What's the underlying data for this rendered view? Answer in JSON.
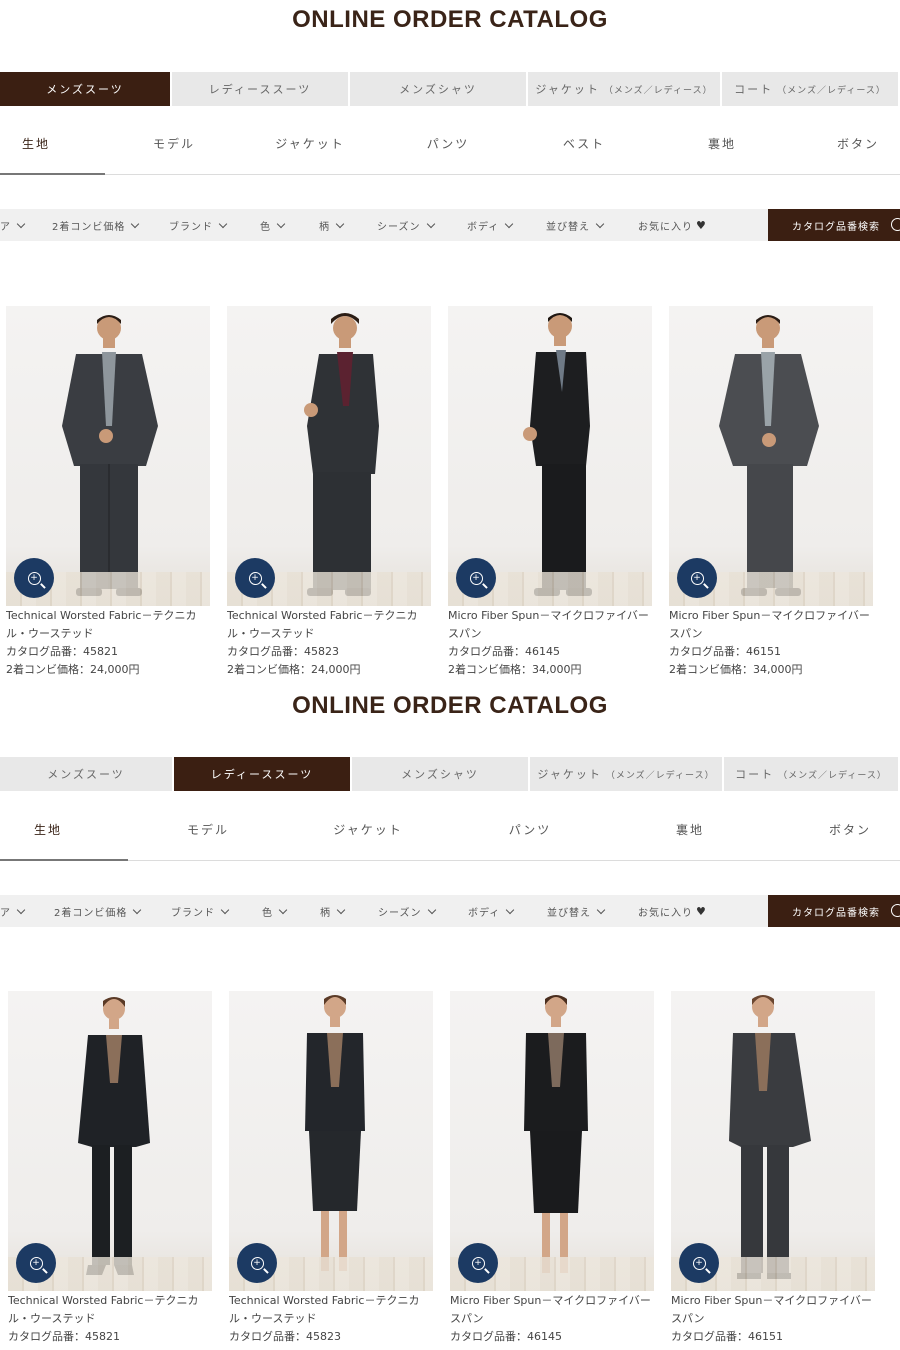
{
  "catalogs": [
    {
      "title": "ONLINE ORDER CATALOG",
      "tabs": [
        {
          "label": "メンズスーツ",
          "sub": ""
        },
        {
          "label": "レディーススーツ",
          "sub": ""
        },
        {
          "label": "メンズシャツ",
          "sub": ""
        },
        {
          "label": "ジャケット",
          "sub": "（メンズ／レディース）"
        },
        {
          "label": "コート",
          "sub": "（メンズ／レディース）"
        }
      ],
      "active_tab": "メンズスーツ",
      "subnav": [
        "生地",
        "モデル",
        "ジャケット",
        "パンツ",
        "ベスト",
        "裏地",
        "ボタン"
      ],
      "active_subnav": "生地",
      "filters": [
        "ア",
        "2着コンビ価格",
        "ブランド",
        "色",
        "柄",
        "シーズン",
        "ボディ",
        "並び替え",
        "お気に入り"
      ],
      "search_button": "カタログ品番検索",
      "products": [
        {
          "name_line1": "Technical Worsted Fabric－テクニカ",
          "name_line2": "ル・ウーステッド",
          "catalog_no": "カタログ品番：45821",
          "price": "2着コンビ価格：24,000円"
        },
        {
          "name_line1": "Technical Worsted Fabric－テクニカ",
          "name_line2": "ル・ウーステッド",
          "catalog_no": "カタログ品番：45823",
          "price": "2着コンビ価格：24,000円"
        },
        {
          "name_line1": "Micro Fiber Spun－マイクロファイバー",
          "name_line2": "スパン",
          "catalog_no": "カタログ品番：46145",
          "price": "2着コンビ価格：34,000円"
        },
        {
          "name_line1": "Micro Fiber Spun－マイクロファイバー",
          "name_line2": "スパン",
          "catalog_no": "カタログ品番：46151",
          "price": "2着コンビ価格：34,000円"
        }
      ]
    },
    {
      "title": "ONLINE ORDER CATALOG",
      "tabs": [
        {
          "label": "メンズスーツ",
          "sub": ""
        },
        {
          "label": "レディーススーツ",
          "sub": ""
        },
        {
          "label": "メンズシャツ",
          "sub": ""
        },
        {
          "label": "ジャケット",
          "sub": "（メンズ／レディース）"
        },
        {
          "label": "コート",
          "sub": "（メンズ／レディース）"
        }
      ],
      "active_tab": "レディーススーツ",
      "subnav": [
        "生地",
        "モデル",
        "ジャケット",
        "パンツ",
        "裏地",
        "ボタン"
      ],
      "active_subnav": "生地",
      "filters": [
        "ア",
        "2着コンビ価格",
        "ブランド",
        "色",
        "柄",
        "シーズン",
        "ボディ",
        "並び替え",
        "お気に入り"
      ],
      "search_button": "カタログ品番検索",
      "products": [
        {
          "name_line1": "Technical Worsted Fabric－テクニカ",
          "name_line2": "ル・ウーステッド",
          "catalog_no": "カタログ品番：45821",
          "price": ""
        },
        {
          "name_line1": "Technical Worsted Fabric－テクニカ",
          "name_line2": "ル・ウーステッド",
          "catalog_no": "カタログ品番：45823",
          "price": ""
        },
        {
          "name_line1": "Micro Fiber Spun－マイクロファイバー",
          "name_line2": "スパン",
          "catalog_no": "カタログ品番：46145",
          "price": ""
        },
        {
          "name_line1": "Micro Fiber Spun－マイクロファイバー",
          "name_line2": "スパン",
          "catalog_no": "カタログ品番：46151",
          "price": ""
        }
      ]
    }
  ],
  "colors": {
    "brand_brown": "#3b1f12",
    "zoom_blue": "#1c3a63",
    "tab_gray": "#e8e8e8",
    "filter_bg": "#f0f0f0"
  },
  "icons": {
    "zoom": "zoom-in-icon",
    "chevron": "chevron-down-icon",
    "heart": "heart-icon",
    "search": "search-icon"
  }
}
